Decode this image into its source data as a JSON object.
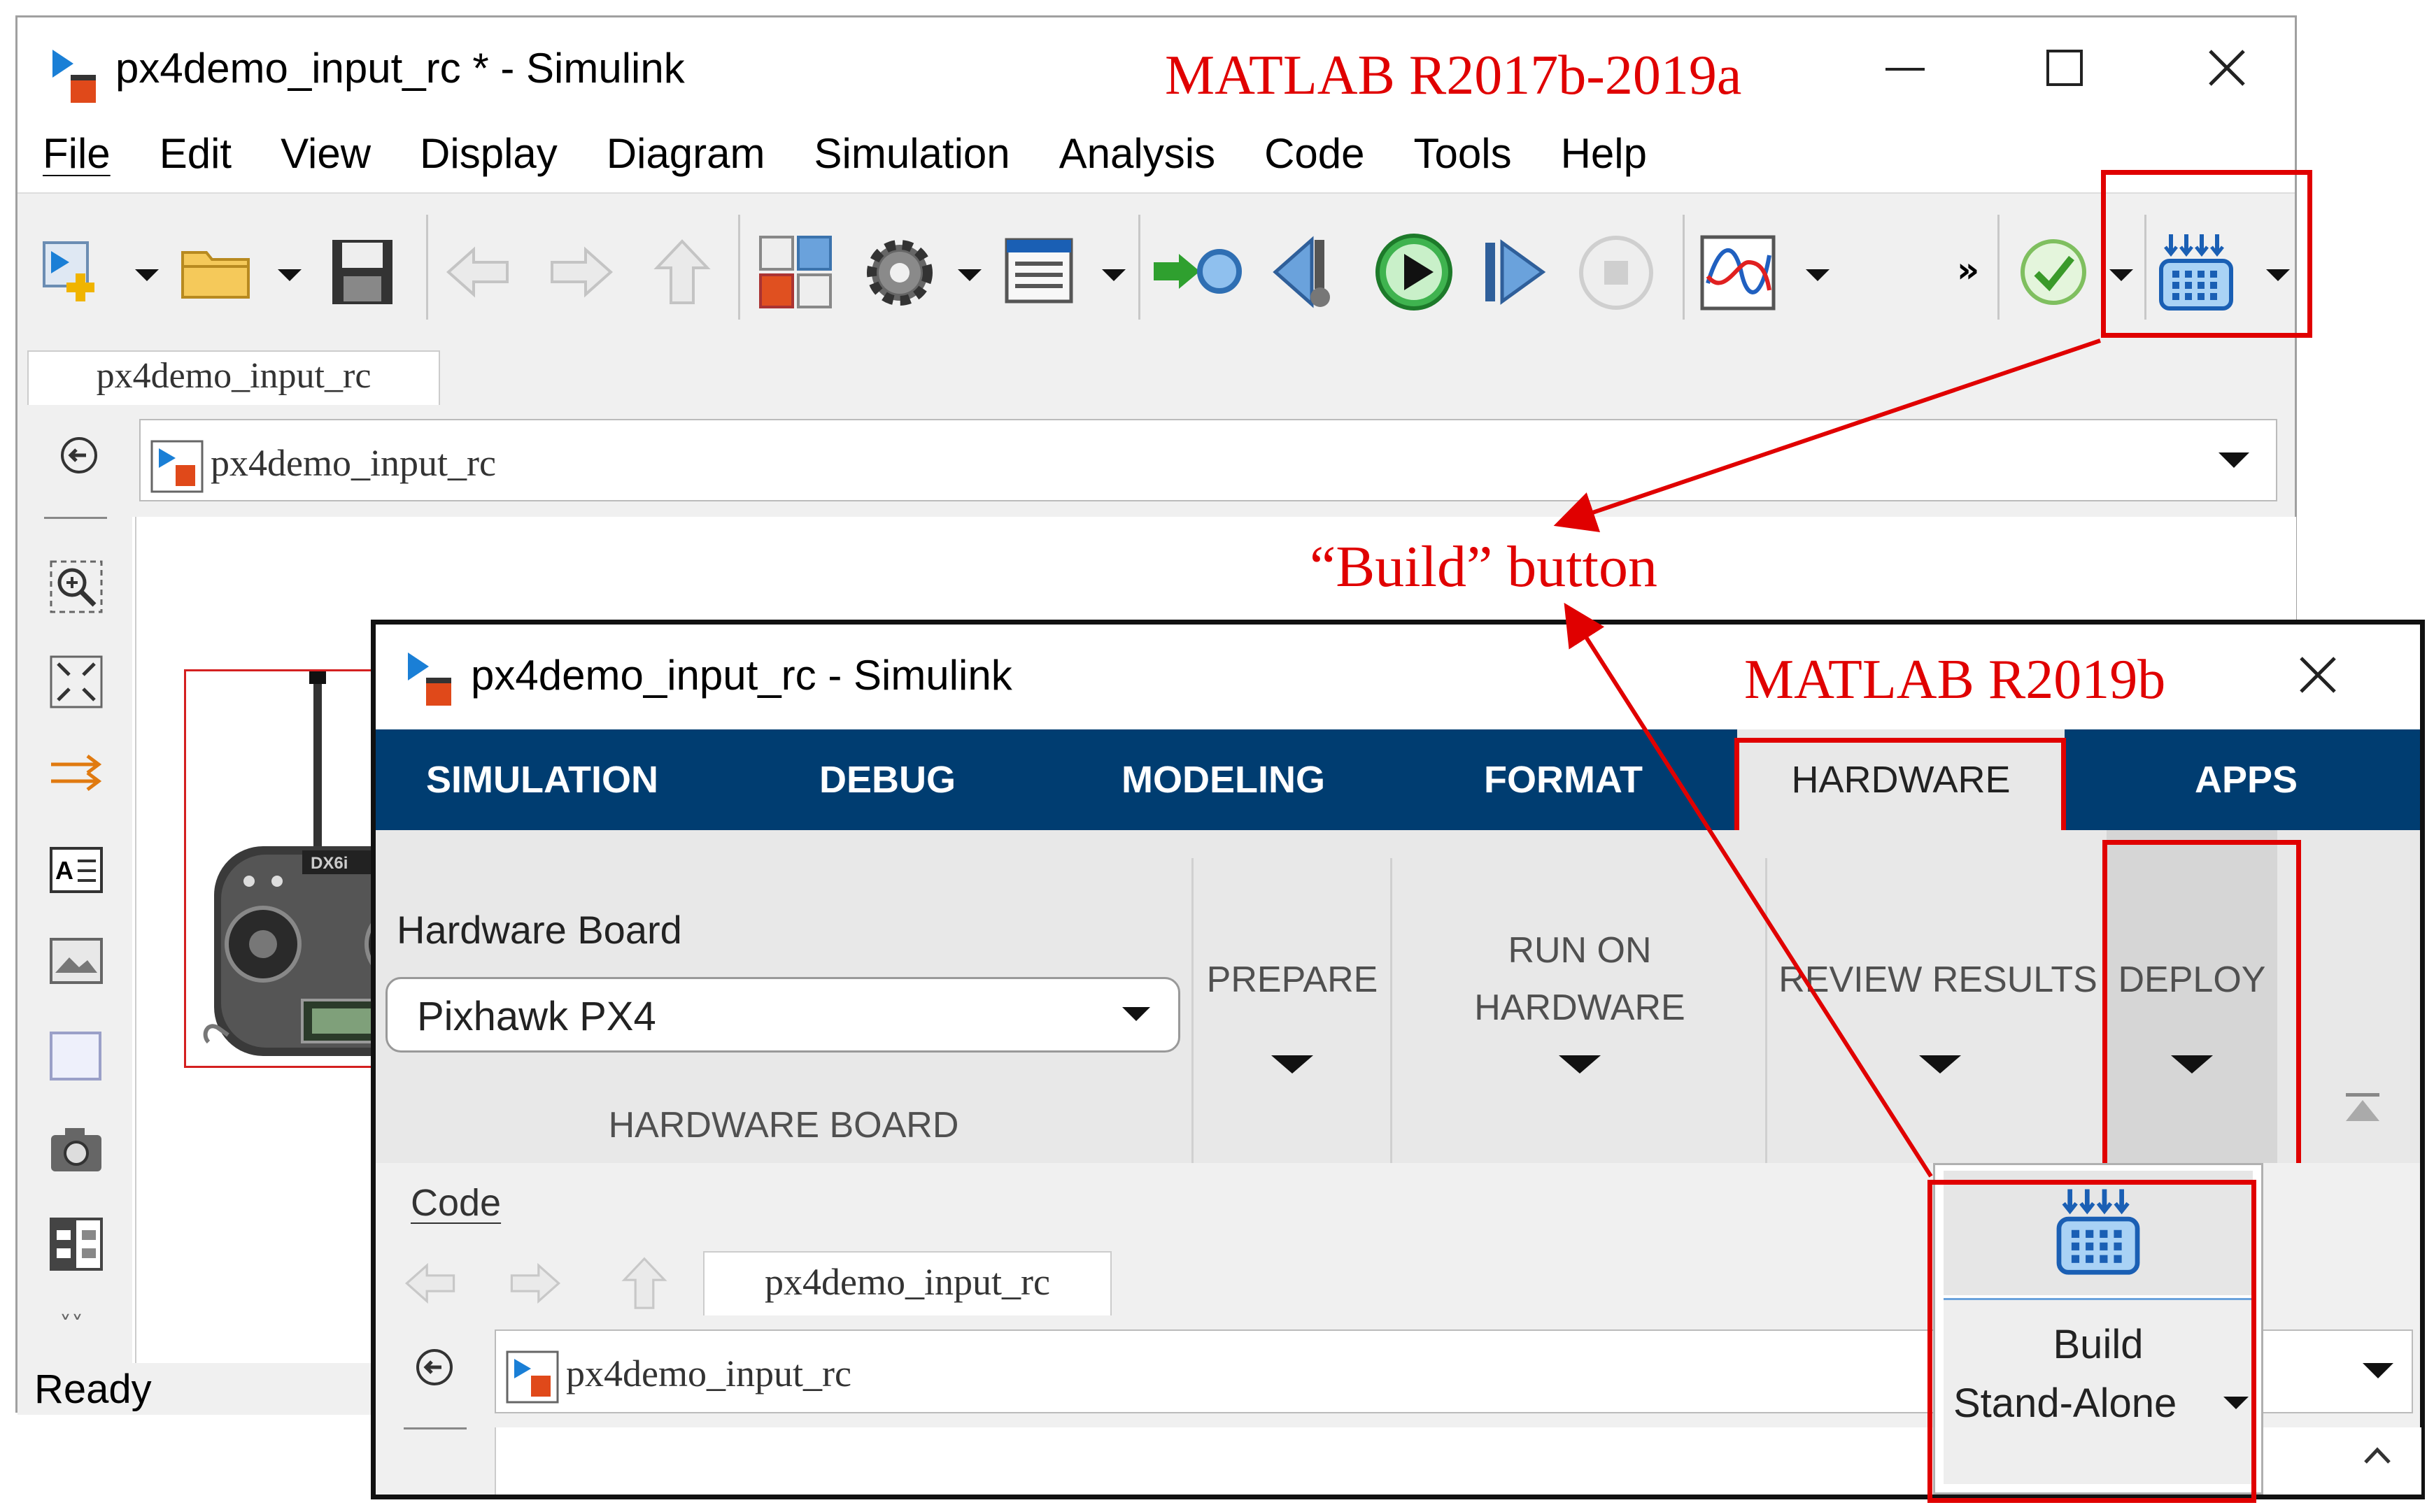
{
  "back_window": {
    "title": "px4demo_input_rc * - Simulink",
    "version_label": "MATLAB R2017b-2019a",
    "window_controls": {
      "minimize": "—",
      "maximize": "☐",
      "close": "✕"
    },
    "menu": [
      "File",
      "Edit",
      "View",
      "Display",
      "Diagram",
      "Simulation",
      "Analysis",
      "Code",
      "Tools",
      "Help"
    ],
    "menu_mnemonics": [
      0,
      0,
      0,
      0,
      0,
      0,
      0,
      0,
      0,
      0
    ],
    "toolbar_overflow": "»",
    "tab_name": "px4demo_input_rc",
    "breadcrumb": "px4demo_input_rc",
    "status": "Ready",
    "block_brand": "DX6i"
  },
  "annotation": {
    "build_button_label": "“Build” button",
    "accent_color": "#e00000"
  },
  "front_window": {
    "title": "px4demo_input_rc - Simulink",
    "version_label": "MATLAB R2019b",
    "close": "✕",
    "tabs": [
      "SIMULATION",
      "DEBUG",
      "MODELING",
      "FORMAT",
      "HARDWARE",
      "APPS"
    ],
    "active_tab": "HARDWARE",
    "ribbon_color": "#003d71",
    "hardware_board_label": "Hardware Board",
    "hardware_board_value": "Pixhawk PX4",
    "section_hardware_board": "HARDWARE BOARD",
    "section_prepare": "PREPARE",
    "section_run_on_hardware_line1": "RUN ON",
    "section_run_on_hardware_line2": "HARDWARE",
    "section_review_results": "REVIEW RESULTS",
    "section_deploy": "DEPLOY",
    "code_label": "Code",
    "tab_name": "px4demo_input_rc",
    "breadcrumb": "px4demo_input_rc",
    "build_line1": "Build",
    "build_line2": "Stand-Alone"
  }
}
